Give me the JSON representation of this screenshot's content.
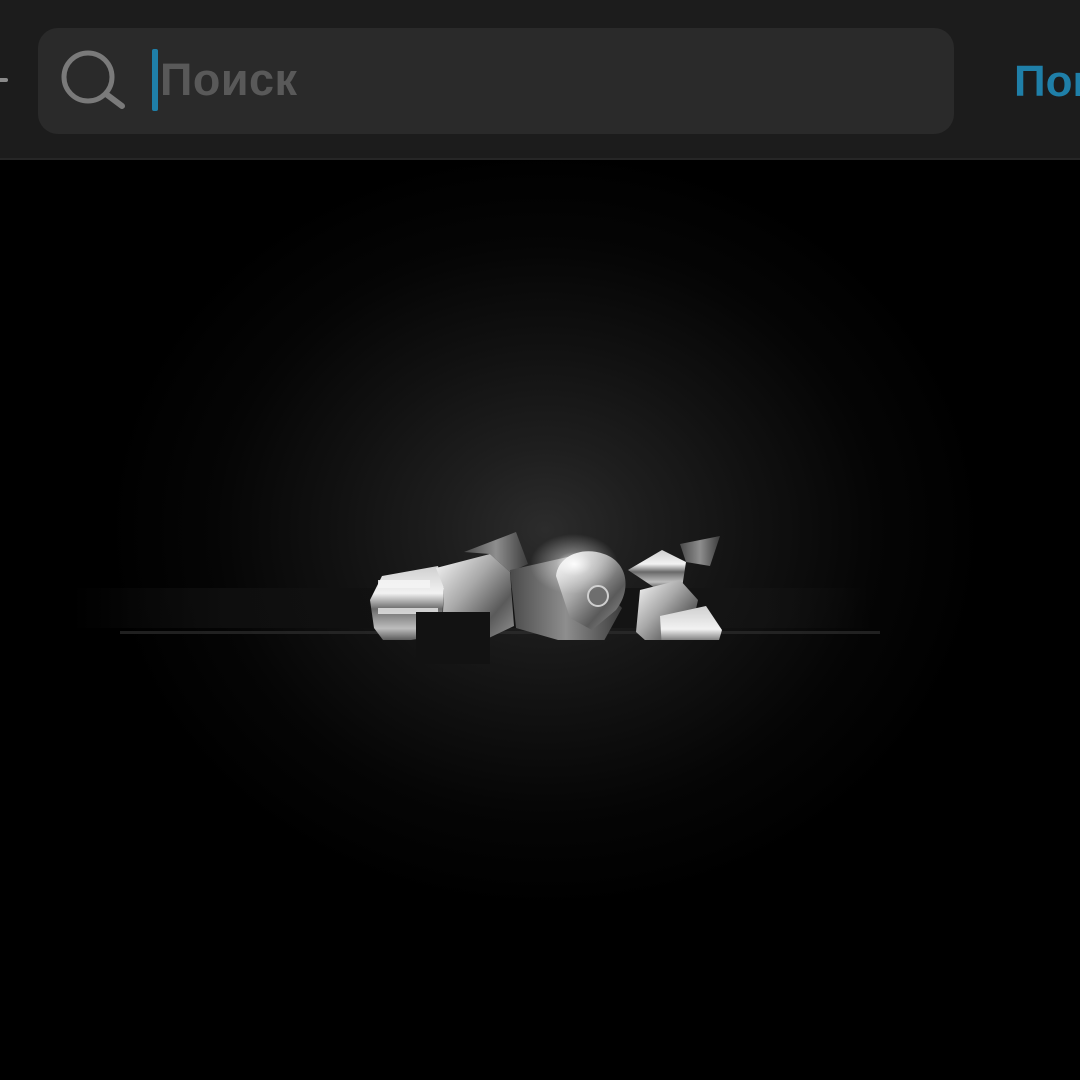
{
  "search": {
    "placeholder": "Поиск",
    "action_label": "Пои"
  },
  "icons": {
    "back": "back-arrow-icon",
    "search": "search-icon",
    "logo": "metallic-3d-logo"
  },
  "colors": {
    "accent": "#1f7fa8",
    "topbar_bg": "#1c1c1c",
    "field_bg": "#2a2a2a",
    "placeholder": "#595959",
    "content_bg": "#000000"
  }
}
